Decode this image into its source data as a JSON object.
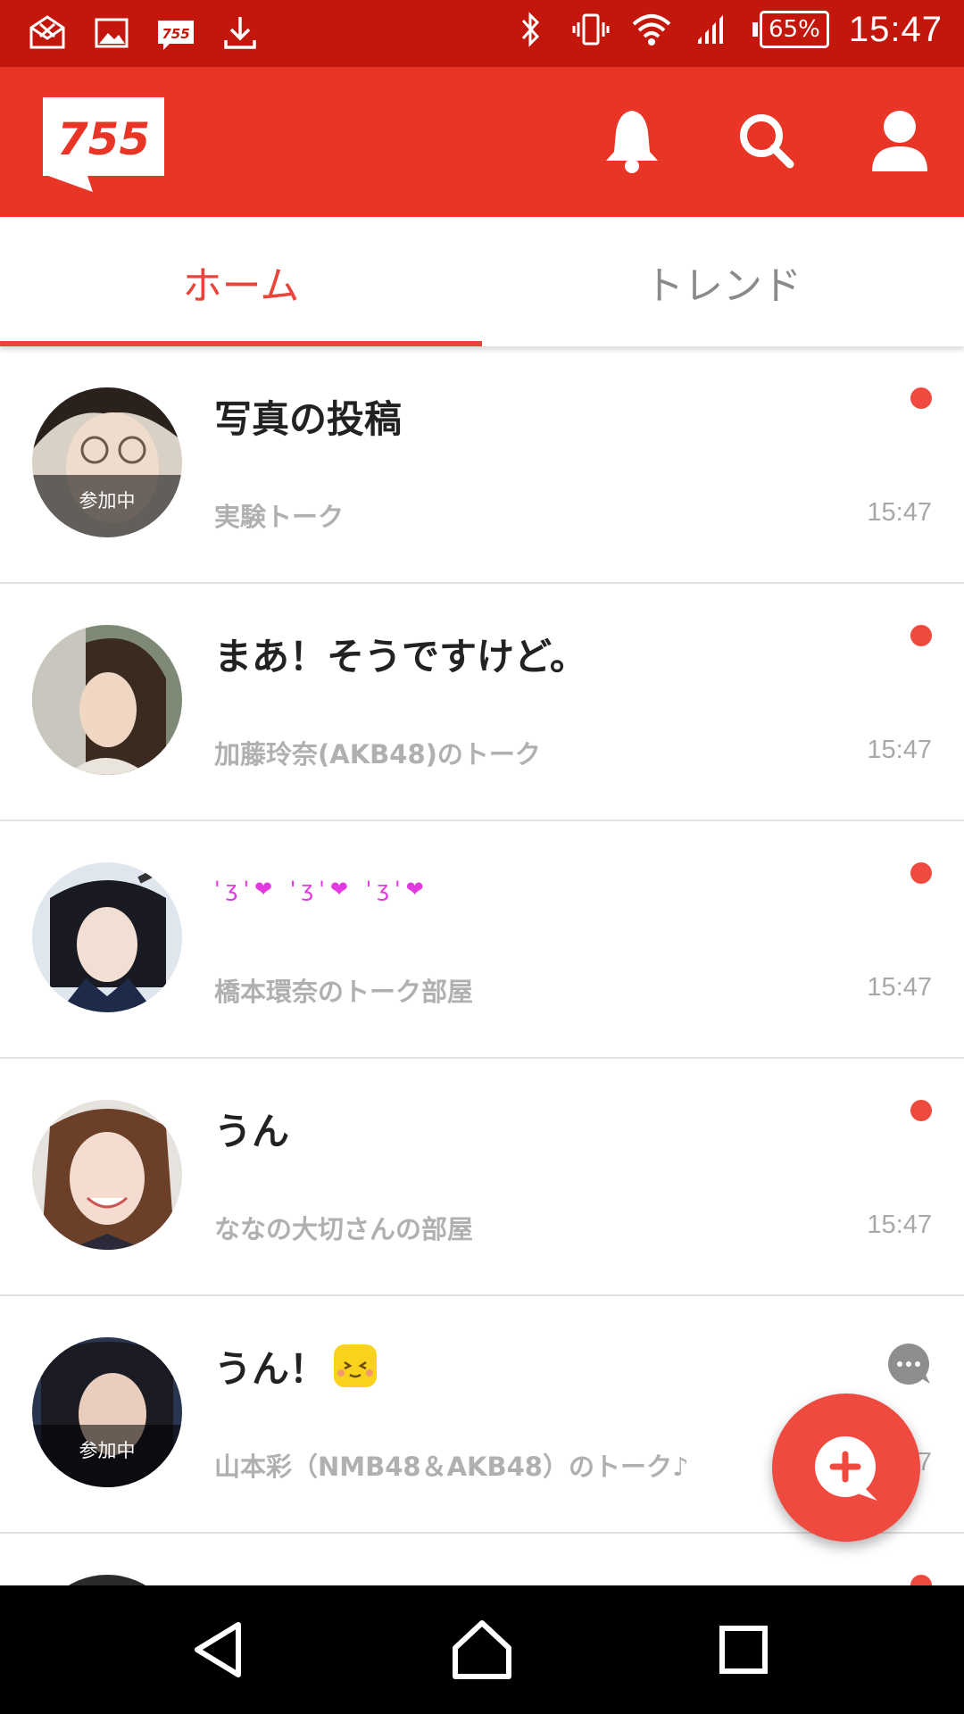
{
  "status_bar": {
    "left_icons": [
      "mail-icon",
      "image-icon",
      "app-755-icon",
      "download-icon"
    ],
    "right_icons": [
      "bluetooth-icon",
      "vibrate-icon",
      "wifi-icon",
      "signal-icon"
    ],
    "battery": "65%",
    "time": "15:47"
  },
  "app_bar": {
    "logo_text": "755",
    "actions": [
      "bell-icon",
      "search-icon",
      "profile-icon"
    ]
  },
  "tabs": [
    {
      "label": "ホーム",
      "active": true
    },
    {
      "label": "トレンド",
      "active": false
    }
  ],
  "feed": [
    {
      "message": "写真の投稿",
      "room": "実験トーク",
      "time": "15:47",
      "joined_label": "参加中",
      "indicator": "unread-dot"
    },
    {
      "message": "まあ！そうですけど。",
      "room": "加藤玲奈(AKB48)のトーク",
      "time": "15:47",
      "indicator": "unread-dot"
    },
    {
      "message": "'ʒ'❤ 'ʒ'❤ 'ʒ'❤",
      "room": "橋本環奈のトーク部屋",
      "time": "15:47",
      "indicator": "unread-dot"
    },
    {
      "message": "うん",
      "room": "ななの大切さんの部屋",
      "time": "15:47",
      "indicator": "unread-dot"
    },
    {
      "message": "うん！",
      "room": "山本彩（NMB48＆AKB48）のトーク♪",
      "time": "15:47",
      "joined_label": "参加中",
      "indicator": "chat-bubble-icon"
    }
  ],
  "fab": {
    "icon": "new-talk-icon"
  },
  "nav_bar": [
    "back-icon",
    "home-icon",
    "recents-icon"
  ],
  "colors": {
    "brand": "#e83525",
    "status_bar": "#c4170c",
    "accent": "#ef4a3f"
  }
}
